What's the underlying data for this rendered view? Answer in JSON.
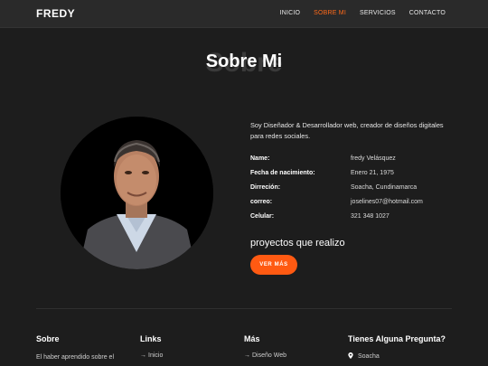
{
  "navbar": {
    "brand": "FREDY",
    "links": [
      {
        "label": "INICIO",
        "active": false
      },
      {
        "label": "SOBRE MI",
        "active": true
      },
      {
        "label": "SERVICIOS",
        "active": false
      },
      {
        "label": "CONTACTO",
        "active": false
      }
    ]
  },
  "section": {
    "title_bg": "Sobre",
    "title": "Sobre Mi"
  },
  "about": {
    "description": "Soy Diseñador & Desarrollador web, creador de diseños digitales para redes sociales.",
    "info": [
      {
        "key": "Name:",
        "value": "fredy Velásquez"
      },
      {
        "key": "Fecha de nacimiento:",
        "value": "Enero 21, 1975"
      },
      {
        "key": "Dirreción:",
        "value": "Soacha, Cundinamarca"
      },
      {
        "key": "correo:",
        "value": "joselines07@hotmail.com"
      },
      {
        "key": "Celular:",
        "value": "321 348 1027"
      }
    ],
    "projects_label": "proyectos que realizo",
    "more_button": "VER MÁS"
  },
  "footer": {
    "col1": {
      "title": "Sobre",
      "text": "El haber aprendido sobre el"
    },
    "col2": {
      "title": "Links",
      "link": "Inicio"
    },
    "col3": {
      "title": "Más",
      "link": "Diseño Web"
    },
    "col4": {
      "title": "Tienes Alguna Pregunta?",
      "location": "Soacha"
    }
  },
  "colors": {
    "accent": "#ff5a12",
    "background": "#1d1d1d",
    "navbar": "#2a2a2a"
  }
}
